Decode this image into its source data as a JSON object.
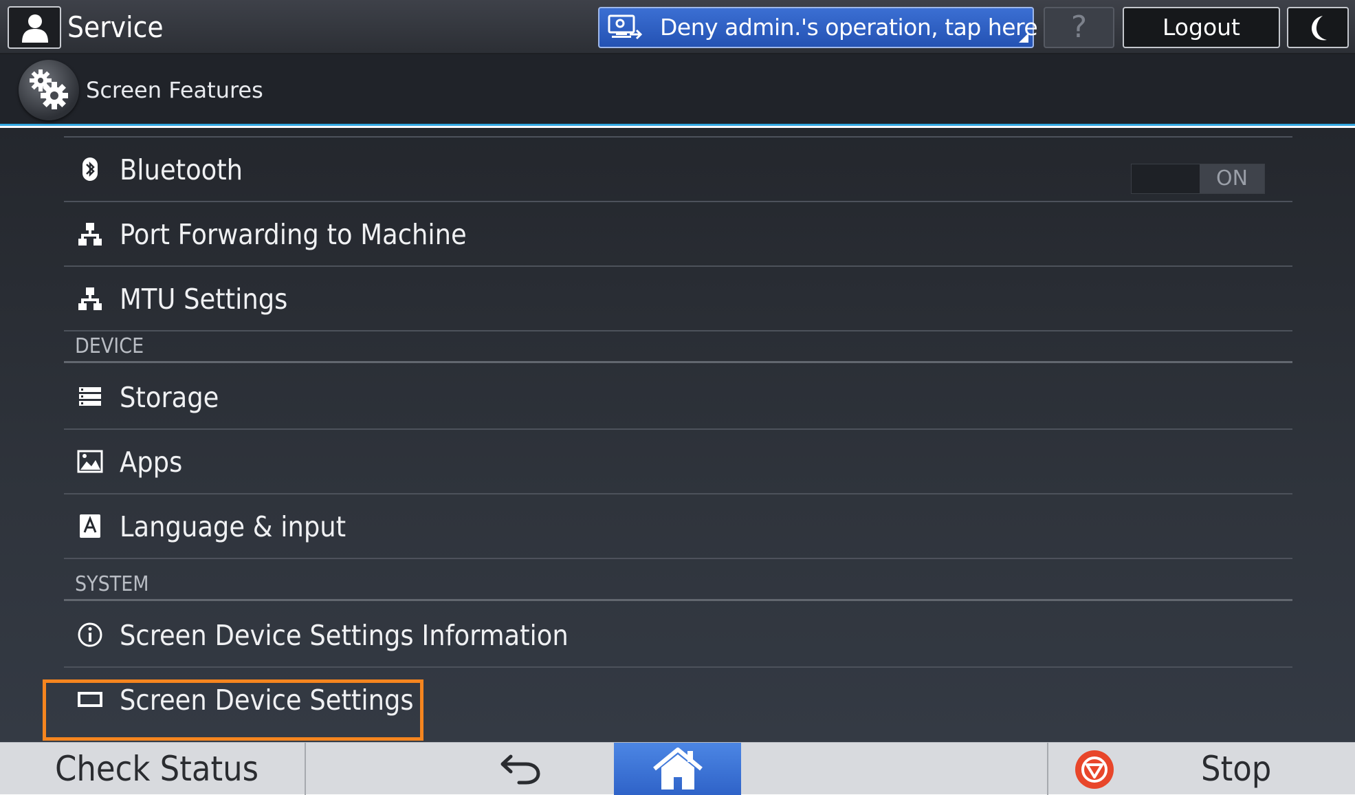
{
  "topbar": {
    "user_title": "Service",
    "deny_label": "Deny admin.'s operation, tap here",
    "help_label": "?",
    "logout_label": "Logout"
  },
  "header": {
    "title": "Screen Features"
  },
  "list": {
    "bluetooth": {
      "label": "Bluetooth",
      "toggle": "ON",
      "icon": "bluetooth-icon"
    },
    "port_forwarding": {
      "label": "Port Forwarding to Machine",
      "icon": "network-icon"
    },
    "mtu": {
      "label": "MTU Settings",
      "icon": "network-icon"
    },
    "section_device": "DEVICE",
    "storage": {
      "label": "Storage",
      "icon": "storage-icon"
    },
    "apps": {
      "label": "Apps",
      "icon": "apps-icon"
    },
    "language": {
      "label": "Language & input",
      "icon": "language-icon"
    },
    "section_system": "SYSTEM",
    "info": {
      "label": "Screen Device Settings Information",
      "icon": "info-icon"
    },
    "screen_settings": {
      "label": "Screen Device Settings",
      "icon": "screen-icon",
      "highlighted": true
    }
  },
  "bottombar": {
    "check_status": "Check Status",
    "stop": "Stop"
  },
  "colors": {
    "accent_blue": "#2f63c8",
    "header_line": "#33a7e0",
    "highlight": "#f5851f",
    "stop_red": "#e8462a"
  }
}
